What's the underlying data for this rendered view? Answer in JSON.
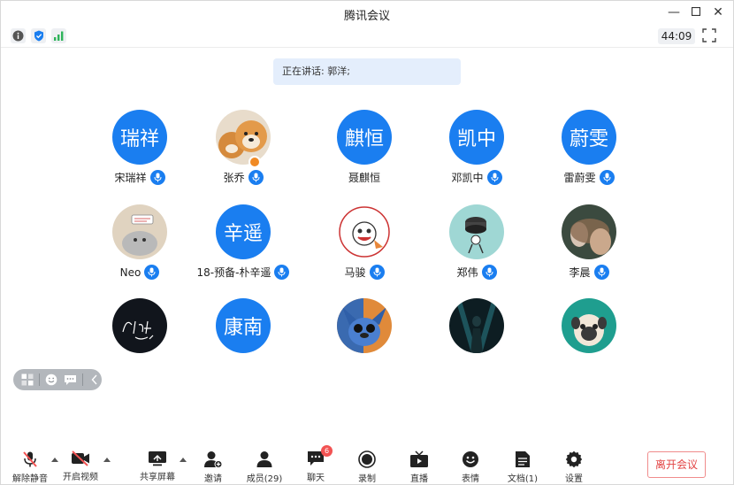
{
  "window": {
    "title": "腾讯会议"
  },
  "status": {
    "timer": "44:09"
  },
  "speaking": {
    "text": "正在讲话: 郭洋;"
  },
  "participants": [
    {
      "name": "宋瑞祥",
      "avatar_text": "瑞祥",
      "avatar_kind": "text",
      "mic": true
    },
    {
      "name": "张乔",
      "avatar_text": "",
      "avatar_kind": "shiba",
      "mic": true,
      "host": true
    },
    {
      "name": "聂麒恒",
      "avatar_text": "麒恒",
      "avatar_kind": "text",
      "mic": false
    },
    {
      "name": "邓凯中",
      "avatar_text": "凯中",
      "avatar_kind": "text",
      "mic": true
    },
    {
      "name": "雷蔚雯",
      "avatar_text": "蔚雯",
      "avatar_kind": "text",
      "mic": true
    },
    {
      "name": "Neo",
      "avatar_text": "",
      "avatar_kind": "cartoon",
      "mic": true
    },
    {
      "name": "18-预备-朴辛遥",
      "avatar_text": "辛遥",
      "avatar_kind": "text",
      "mic": true
    },
    {
      "name": "马骏",
      "avatar_text": "",
      "avatar_kind": "seal",
      "mic": true
    },
    {
      "name": "郑伟",
      "avatar_text": "",
      "avatar_kind": "speaker",
      "mic": true
    },
    {
      "name": "李晨",
      "avatar_text": "",
      "avatar_kind": "portrait",
      "mic": true
    },
    {
      "name": "",
      "avatar_text": "",
      "avatar_kind": "dark-script",
      "mic": false
    },
    {
      "name": "",
      "avatar_text": "康南",
      "avatar_kind": "text",
      "mic": false
    },
    {
      "name": "",
      "avatar_text": "",
      "avatar_kind": "stitch",
      "mic": false
    },
    {
      "name": "",
      "avatar_text": "",
      "avatar_kind": "dark-figure",
      "mic": false
    },
    {
      "name": "",
      "avatar_text": "",
      "avatar_kind": "pug",
      "mic": false
    }
  ],
  "toolbar": {
    "unmute": "解除静音",
    "start_video": "开启视频",
    "share_screen": "共享屏幕",
    "invite": "邀请",
    "members": "成员(29)",
    "chat": "聊天",
    "chat_badge": "6",
    "record": "录制",
    "live": "直播",
    "reactions": "表情",
    "docs": "文档(1)",
    "settings": "设置",
    "leave": "离开会议"
  },
  "colors": {
    "accent": "#1a7ef0",
    "leave": "#e24343",
    "banner": "#e4eefc"
  }
}
